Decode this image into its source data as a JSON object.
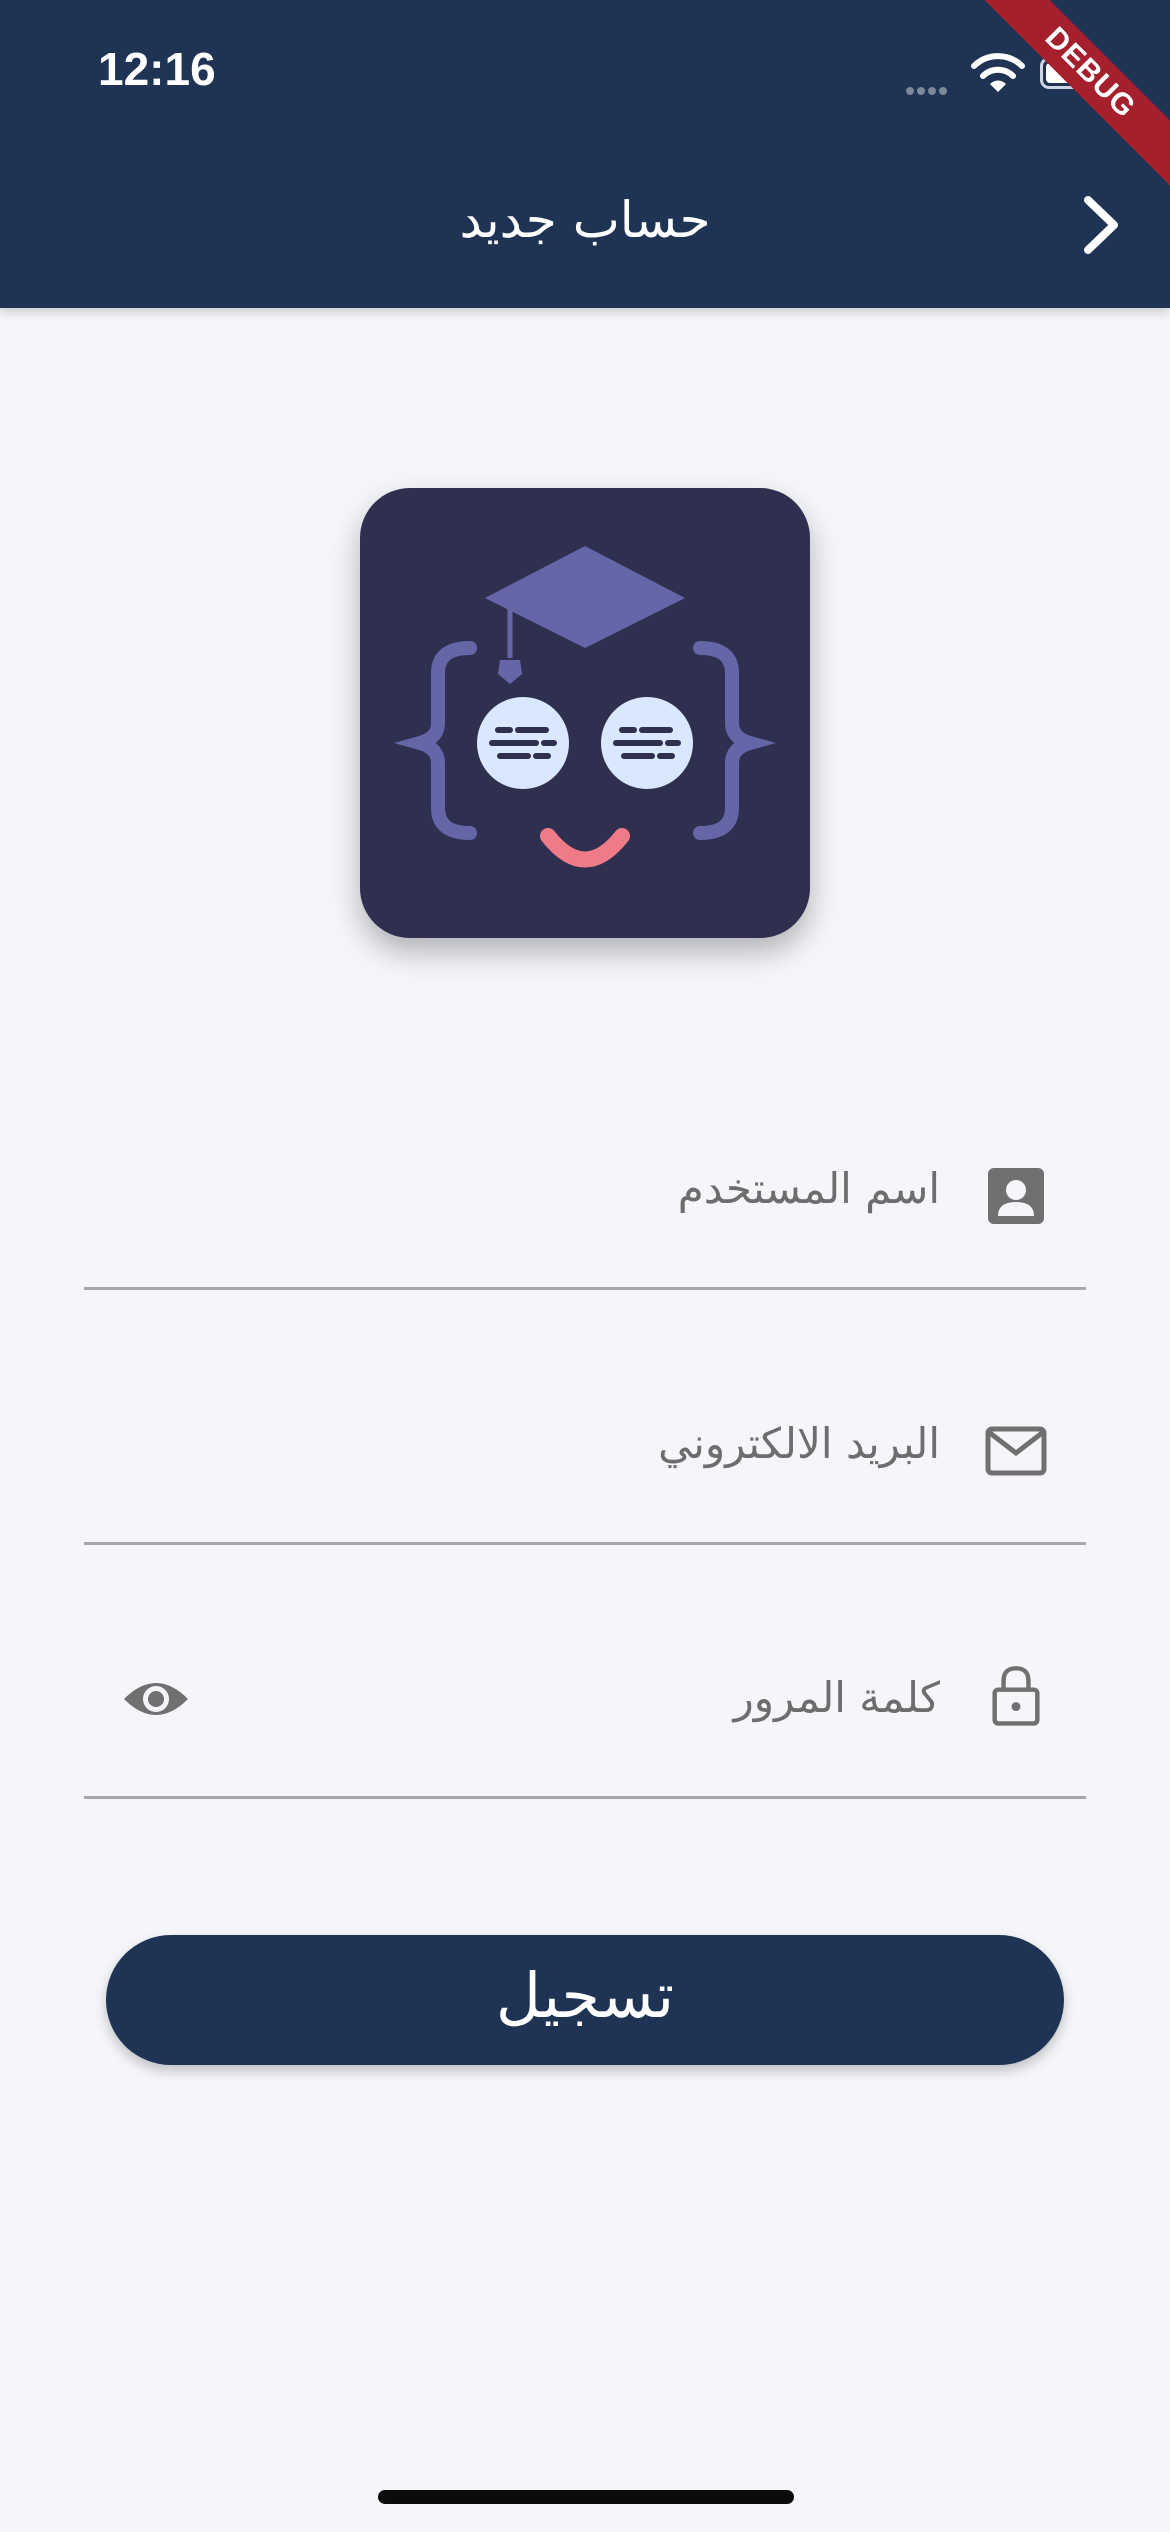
{
  "status_bar": {
    "time": "12:16"
  },
  "debug_banner": "DEBUG",
  "header": {
    "title": "حساب جديد",
    "back_icon": "chevron-right-icon"
  },
  "logo": {
    "name": "robot-graduate-logo"
  },
  "form": {
    "username": {
      "placeholder": "اسم المستخدم",
      "icon": "person-icon"
    },
    "email": {
      "placeholder": "البريد الالكتروني",
      "icon": "mail-icon"
    },
    "password": {
      "placeholder": "كلمة المرور",
      "icon": "lock-icon",
      "toggle_icon": "eye-icon"
    }
  },
  "submit": {
    "label": "تسجيل"
  },
  "colors": {
    "primary": "#1f3354",
    "background": "#f5f6fa",
    "logo_bg": "#2f2f50",
    "logo_accent": "#6466a8",
    "smile": "#ef7b88"
  }
}
